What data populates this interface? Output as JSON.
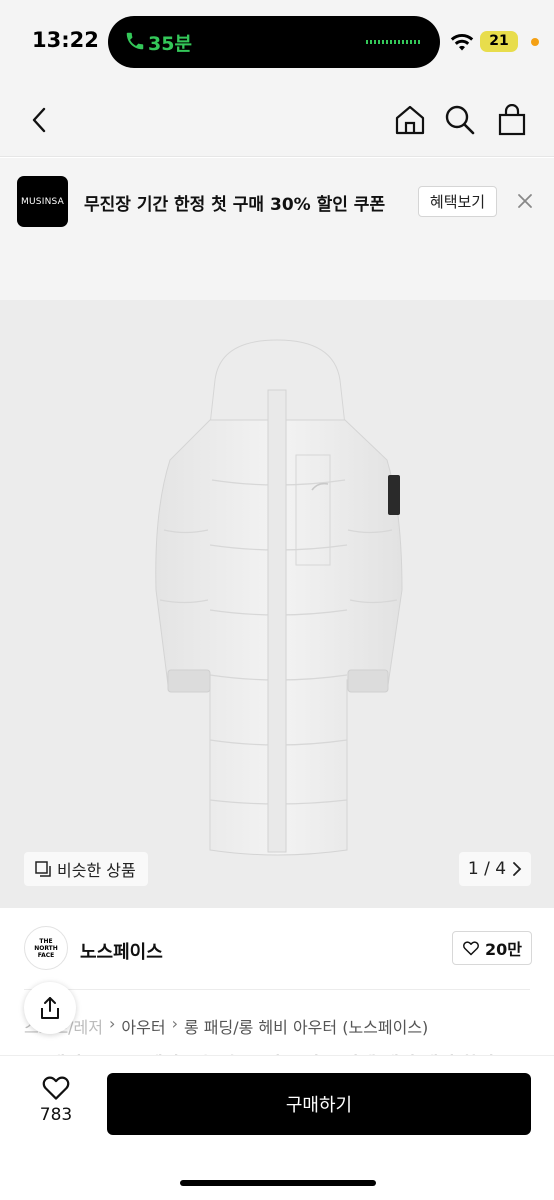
{
  "status": {
    "time": "13:22",
    "call_duration": "35분",
    "battery": "21",
    "colors": {
      "call_green": "#34c759",
      "battery_yellow": "#e8dd4c",
      "dot_orange": "#f4a014"
    }
  },
  "nav": {
    "back_icon": "chevron-left-icon",
    "icons": [
      "home-icon",
      "search-icon",
      "bag-icon"
    ]
  },
  "banner": {
    "logo_text": "MUSINSA",
    "text": "무진장 기간 한정 첫 구매 30% 할인 쿠폰",
    "button_label": "혜택보기",
    "close_icon": "close-icon"
  },
  "gallery": {
    "similar_label": "비슷한 상품",
    "pager": "1 / 4"
  },
  "brand": {
    "logo_lines": [
      "THE",
      "NORTH",
      "FACE"
    ],
    "name": "노스페이스",
    "like_count": "20만"
  },
  "breadcrumb": {
    "items": [
      "스포츠/레저",
      "아우터",
      "롱 패딩/롱 헤비 아우터 (노스페이스)"
    ]
  },
  "title_peek": "[국내정품] 노스페이스 눕시 롱 리모 다운 자켓 헤비 패딩 화이트",
  "bottom": {
    "wish_count": "783",
    "buy_label": "구매하기"
  }
}
